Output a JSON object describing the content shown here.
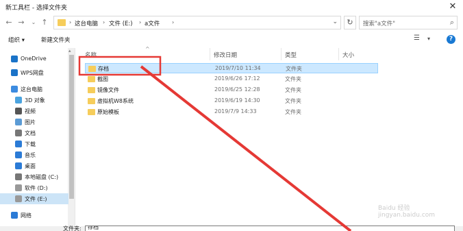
{
  "window": {
    "title": "新工具栏 - 选择文件夹"
  },
  "address": {
    "crumbs": [
      "这台电脑",
      "文件 (E:)",
      "a文件"
    ],
    "search_placeholder": "搜索\"a文件\""
  },
  "toolbar": {
    "organize": "组织 ▾",
    "new_folder": "新建文件夹"
  },
  "sidebar": {
    "items": [
      {
        "label": "OneDrive",
        "icon": "cloud-icon",
        "color": "#1a73c8"
      },
      {
        "label": "WPS网盘",
        "icon": "cloud-icon",
        "color": "#1a73c8"
      },
      {
        "label": "这台电脑",
        "icon": "computer-icon",
        "color": "#3c8be0"
      },
      {
        "label": "3D 对象",
        "icon": "cube-icon",
        "color": "#4aa3df"
      },
      {
        "label": "视频",
        "icon": "video-icon",
        "color": "#555"
      },
      {
        "label": "图片",
        "icon": "pictures-icon",
        "color": "#5b9bd5"
      },
      {
        "label": "文档",
        "icon": "document-icon",
        "color": "#777"
      },
      {
        "label": "下载",
        "icon": "download-icon",
        "color": "#2b7bd6"
      },
      {
        "label": "音乐",
        "icon": "music-icon",
        "color": "#2b7bd6"
      },
      {
        "label": "桌面",
        "icon": "desktop-icon",
        "color": "#2b7bd6"
      },
      {
        "label": "本地磁盘 (C:)",
        "icon": "drive-icon",
        "color": "#777"
      },
      {
        "label": "软件 (D:)",
        "icon": "drive-icon",
        "color": "#999"
      },
      {
        "label": "文件 (E:)",
        "icon": "drive-icon",
        "color": "#999"
      },
      {
        "label": "网络",
        "icon": "network-icon",
        "color": "#2b7bd6"
      }
    ]
  },
  "columns": [
    "名称",
    "修改日期",
    "类型",
    "大小"
  ],
  "files": [
    {
      "name": "存档",
      "date": "2019/7/10 11:34",
      "type": "文件夹"
    },
    {
      "name": "截图",
      "date": "2019/6/26 17:12",
      "type": "文件夹"
    },
    {
      "name": "镜像文件",
      "date": "2019/6/25 12:28",
      "type": "文件夹"
    },
    {
      "name": "虚拟机W8系统",
      "date": "2019/6/19 14:30",
      "type": "文件夹"
    },
    {
      "name": "原始模板",
      "date": "2019/7/9 14:33",
      "type": "文件夹"
    }
  ],
  "filename": {
    "label": "文件夹:",
    "value": "存档"
  },
  "annotation_color": "#e53935",
  "watermark": "Baidu 经验  jingyan.baidu.com"
}
